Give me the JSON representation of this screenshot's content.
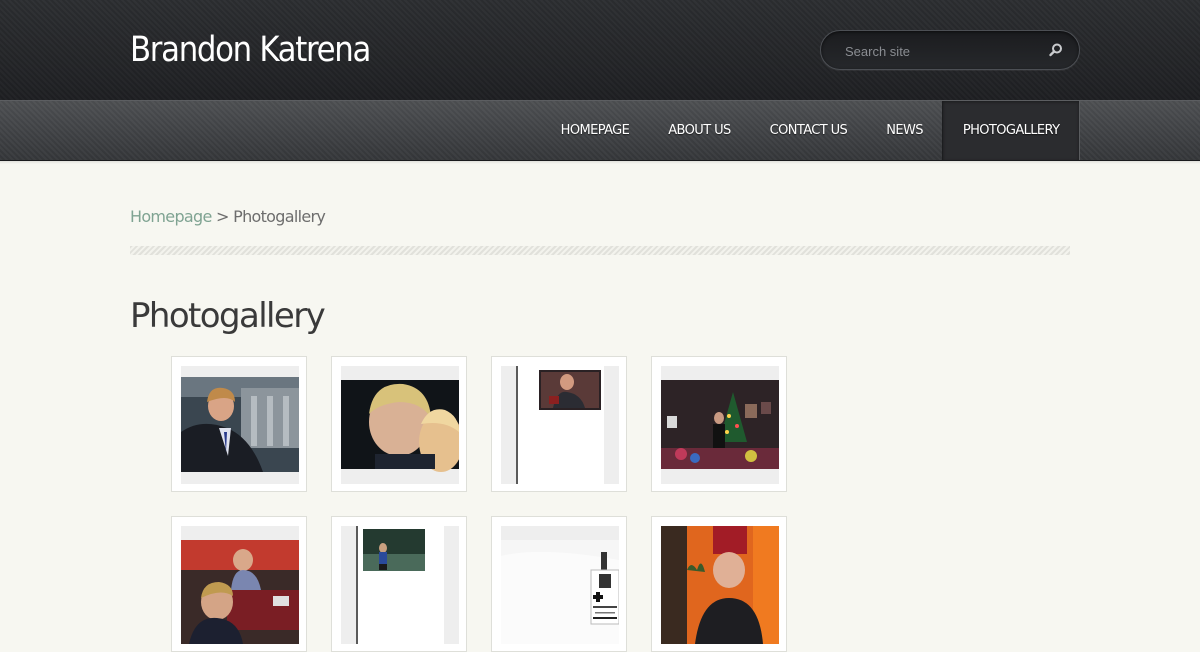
{
  "header": {
    "site_title": "Brandon Katrena",
    "search": {
      "placeholder": "Search site",
      "value": ""
    }
  },
  "nav": {
    "items": [
      {
        "label": "HOMEPAGE"
      },
      {
        "label": "ABOUT US"
      },
      {
        "label": "CONTACT US"
      },
      {
        "label": "NEWS"
      },
      {
        "label": "PHOTOGALLERY",
        "active": true
      }
    ]
  },
  "breadcrumb": {
    "home": "Homepage",
    "separator": ">",
    "current": "Photogallery"
  },
  "main": {
    "title": "Photogallery"
  },
  "gallery": {
    "photos": [
      {
        "icon": "photo-young-man-in-suit"
      },
      {
        "icon": "photo-two-people-selfie"
      },
      {
        "icon": "photo-scanned-page-with-picture"
      },
      {
        "icon": "photo-christmas-tree-room"
      },
      {
        "icon": "photo-people-at-dinner-table"
      },
      {
        "icon": "photo-scanned-page-outdoor-picture"
      },
      {
        "icon": "photo-volunteer-badge"
      },
      {
        "icon": "photo-man-in-red-fez"
      }
    ]
  },
  "colors": {
    "header_bg": "#26282b",
    "nav_bg": "#414346",
    "page_bg": "#f7f7f1",
    "breadcrumb_link": "#7fa392",
    "title_text": "#3a3a3a"
  }
}
